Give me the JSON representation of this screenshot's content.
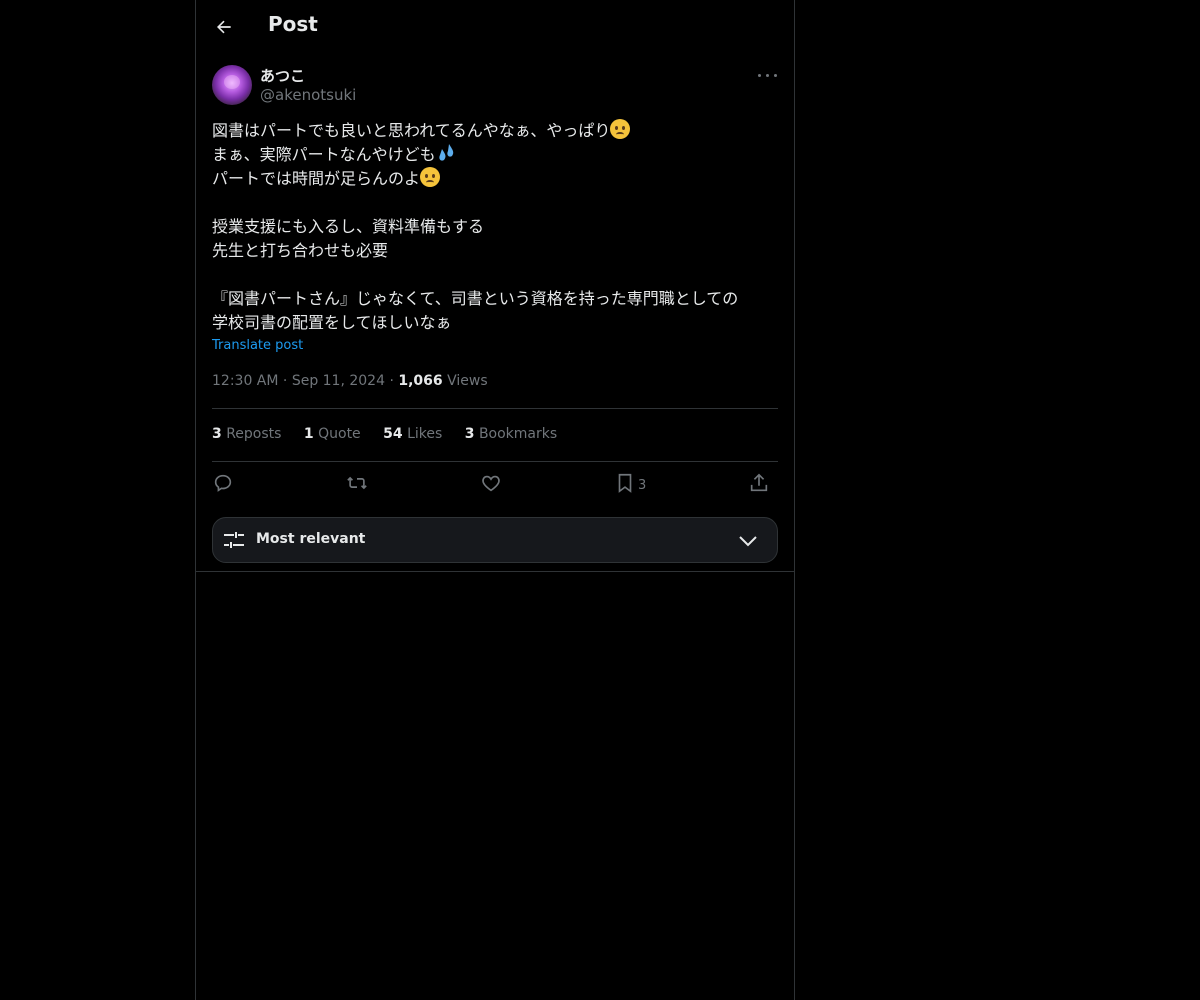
{
  "header": {
    "title": "Post"
  },
  "author": {
    "display_name": "あつこ",
    "handle": "@akenotsuki"
  },
  "post": {
    "lines": [
      "図書はパートでも良いと思われてるんやなぁ、やっぱり",
      "まぁ、実際パートなんやけども",
      "パートでは時間が足らんのよ",
      "",
      "授業支援にも入るし、資料準備もする",
      "先生と打ち合わせも必要",
      "",
      "『図書パートさん』じゃなくて、司書という資格を持った専門職としての",
      "学校司書の配置をしてほしいなぁ"
    ],
    "translate_label": "Translate post",
    "time": "12:30 AM",
    "date": "Sep 11, 2024",
    "views_count": "1,066",
    "views_label": "Views"
  },
  "stats": {
    "reposts_count": "3",
    "reposts_label": "Reposts",
    "quotes_count": "1",
    "quotes_label": "Quote",
    "likes_count": "54",
    "likes_label": "Likes",
    "bookmarks_count": "3",
    "bookmarks_label": "Bookmarks"
  },
  "actions": {
    "bookmark_count": "3"
  },
  "sort": {
    "label": "Most relevant"
  },
  "icons": [
    "back-arrow-icon",
    "more-icon",
    "reply-icon",
    "repost-icon",
    "like-icon",
    "bookmark-icon",
    "share-icon",
    "sliders-icon",
    "chevron-down-icon"
  ],
  "colors": {
    "accent": "#1d9bf0",
    "background": "#000000",
    "border": "#2f3336",
    "muted": "#71767b"
  }
}
